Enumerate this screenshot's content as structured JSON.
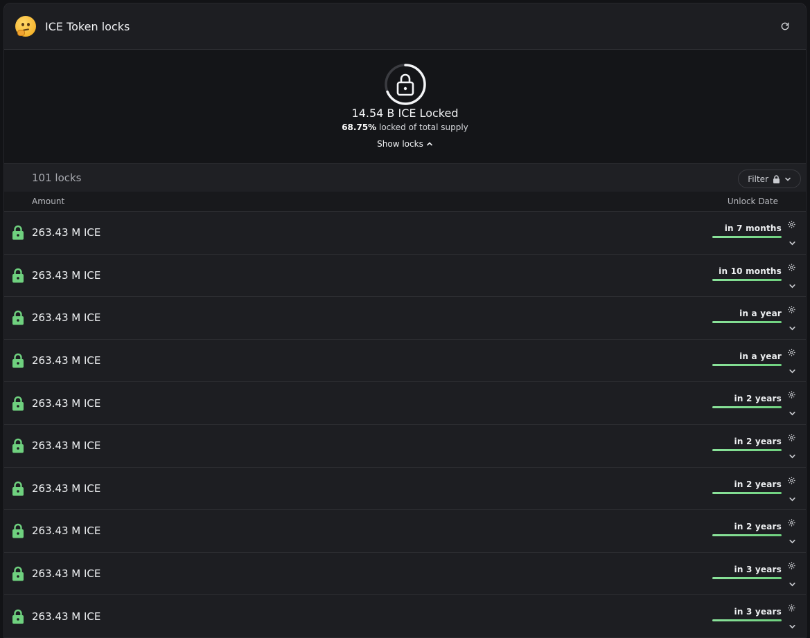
{
  "header": {
    "title": "ICE Token locks"
  },
  "summary": {
    "total_locked": "14.54 B ICE Locked",
    "percent": "68.75%",
    "percent_suffix": " locked of total supply",
    "locked_fraction": 0.6875,
    "show_locks": "Show locks"
  },
  "toolbar": {
    "count": "101 locks",
    "filter_label": "Filter"
  },
  "columns": {
    "amount": "Amount",
    "unlock": "Unlock Date"
  },
  "colors": {
    "accent_green": "#6fd17f",
    "background": "#1d1e22"
  },
  "rows": [
    {
      "amount": "263.43 M ICE",
      "unlock": "in 7 months"
    },
    {
      "amount": "263.43 M ICE",
      "unlock": "in 10 months"
    },
    {
      "amount": "263.43 M ICE",
      "unlock": "in a year"
    },
    {
      "amount": "263.43 M ICE",
      "unlock": "in a year"
    },
    {
      "amount": "263.43 M ICE",
      "unlock": "in 2 years"
    },
    {
      "amount": "263.43 M ICE",
      "unlock": "in 2 years"
    },
    {
      "amount": "263.43 M ICE",
      "unlock": "in 2 years"
    },
    {
      "amount": "263.43 M ICE",
      "unlock": "in 2 years"
    },
    {
      "amount": "263.43 M ICE",
      "unlock": "in 3 years"
    },
    {
      "amount": "263.43 M ICE",
      "unlock": "in 3 years"
    }
  ]
}
